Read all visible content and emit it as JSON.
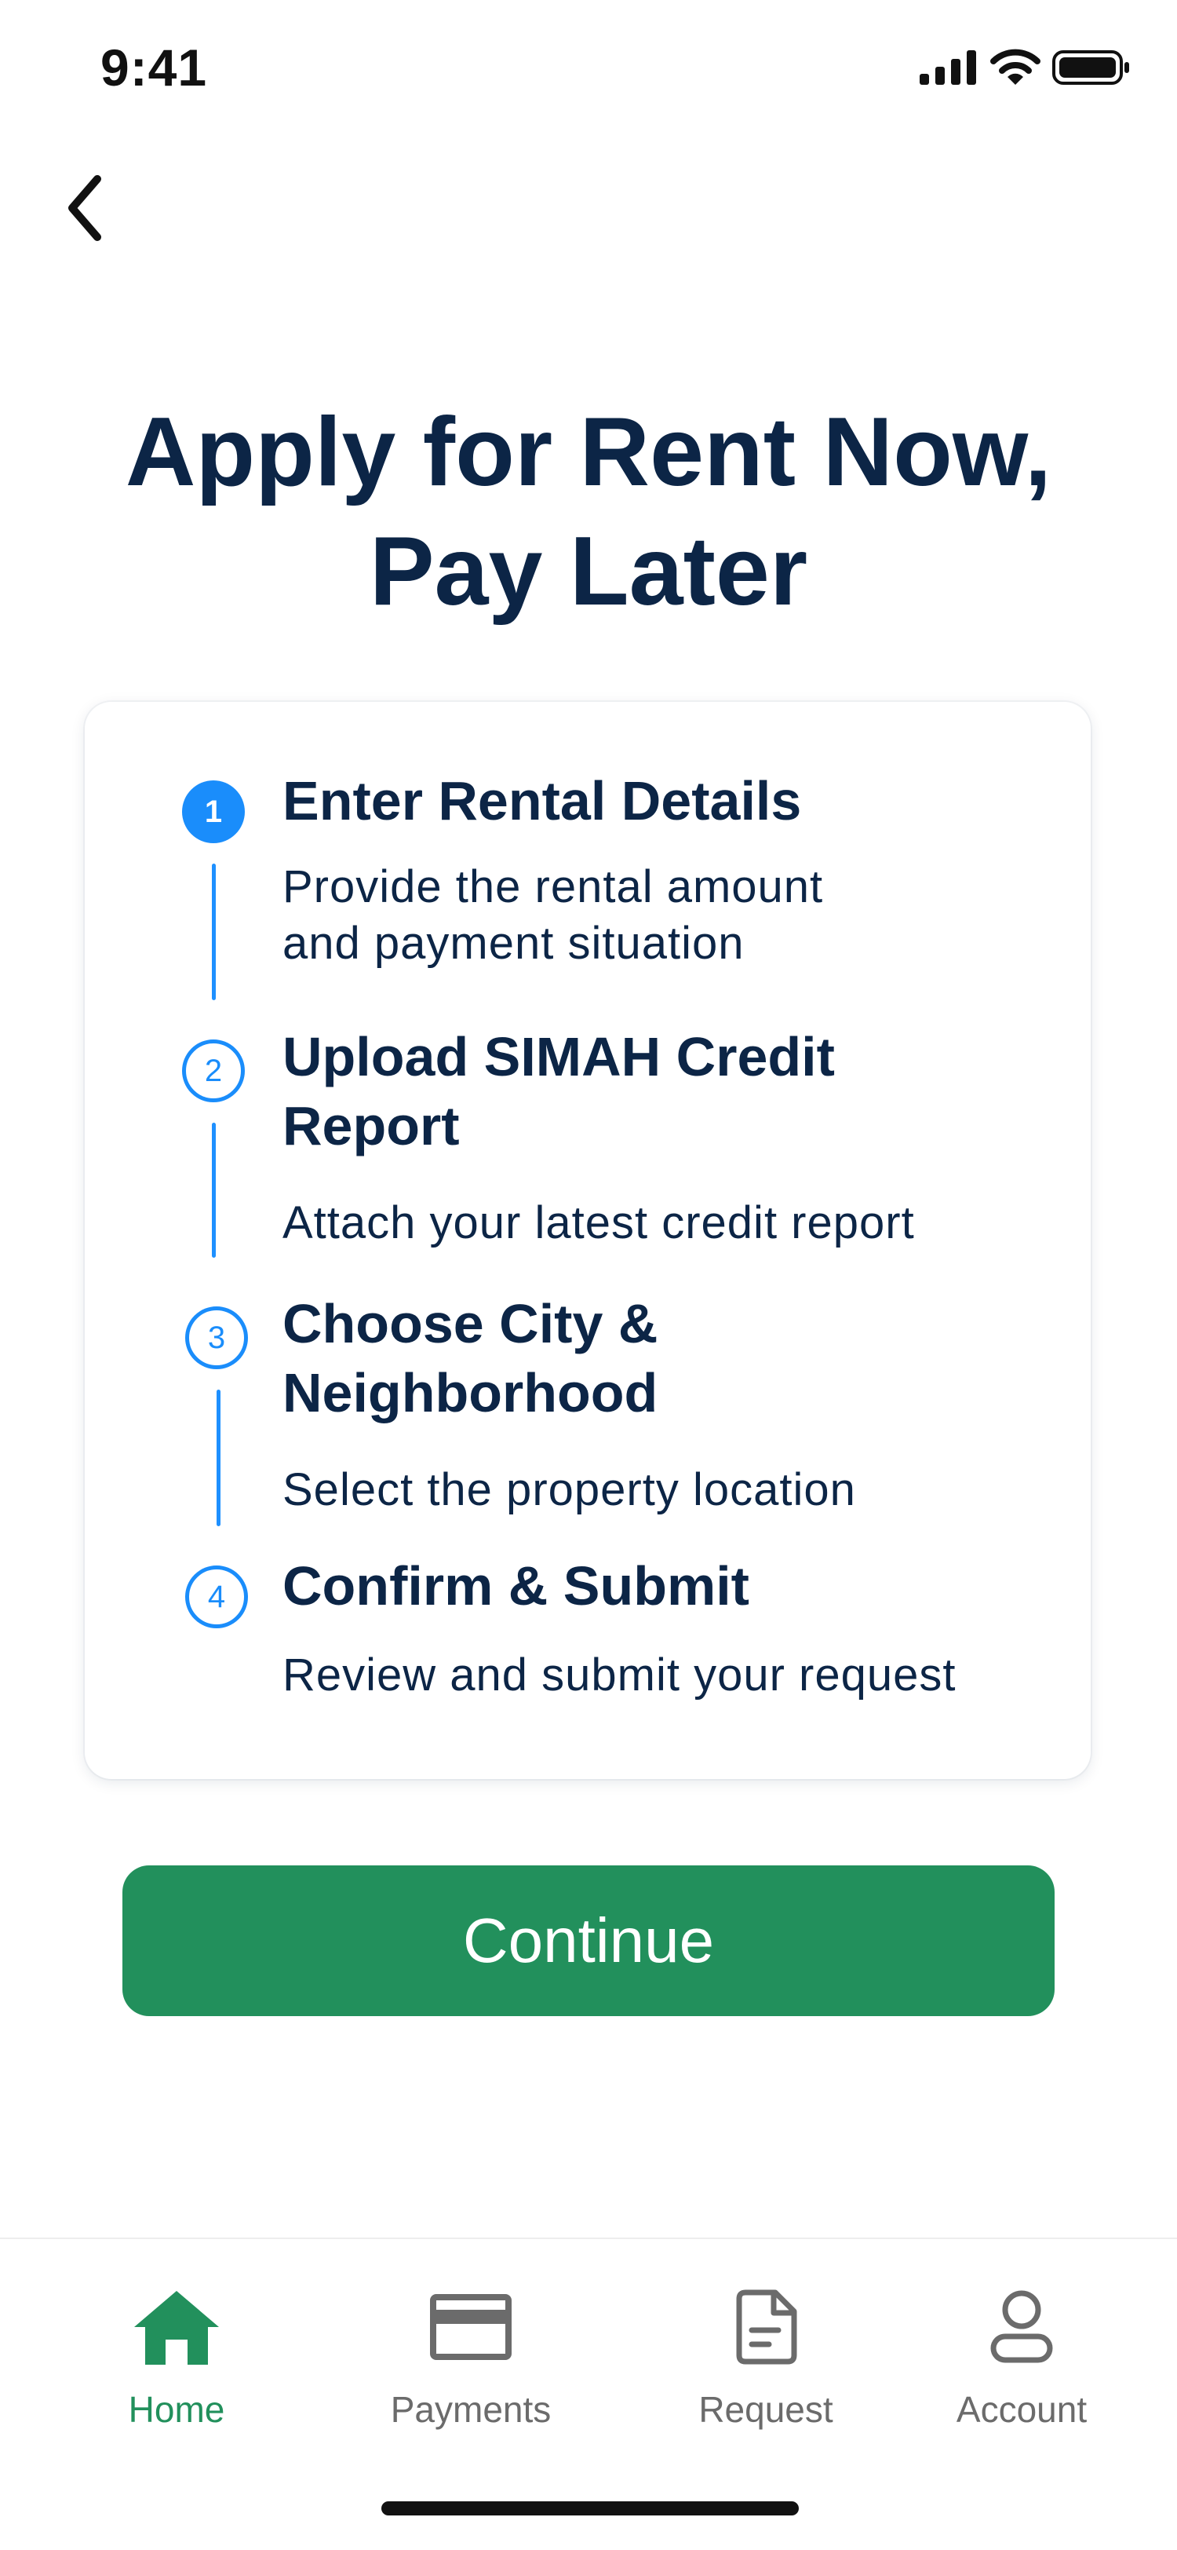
{
  "status_bar": {
    "time": "9:41"
  },
  "navigation": {
    "back_icon": "chevron-left-icon"
  },
  "title": {
    "line1": "Apply for Rent Now,",
    "line2": "Pay Later"
  },
  "steps": [
    {
      "number": "1",
      "title": "Enter Rental Details",
      "description_line1": "Provide the rental amount",
      "description_line2": "and payment situation",
      "state": "active"
    },
    {
      "number": "2",
      "title_line1": "Upload SIMAH Credit",
      "title_line2": "Report",
      "description": "Attach your latest credit report",
      "state": "upcoming"
    },
    {
      "number": "3",
      "title_line1": "Choose City &",
      "title_line2": "Neighborhood",
      "description": "Select the property location",
      "state": "upcoming"
    },
    {
      "number": "4",
      "title": "Confirm & Submit",
      "description": "Review and submit your request",
      "state": "upcoming"
    }
  ],
  "primary_action": {
    "label": "Continue"
  },
  "tab_bar": {
    "items": [
      {
        "label": "Home",
        "icon": "home-icon",
        "active": true
      },
      {
        "label": "Payments",
        "icon": "credit-card-icon",
        "active": false
      },
      {
        "label": "Request",
        "icon": "document-icon",
        "active": false
      },
      {
        "label": "Account",
        "icon": "user-icon",
        "active": false
      }
    ]
  },
  "colors": {
    "primary_text": "#0c2546",
    "accent_blue": "#1a8dfb",
    "brand_green": "#22905c",
    "inactive_gray": "#6b6b6b"
  }
}
